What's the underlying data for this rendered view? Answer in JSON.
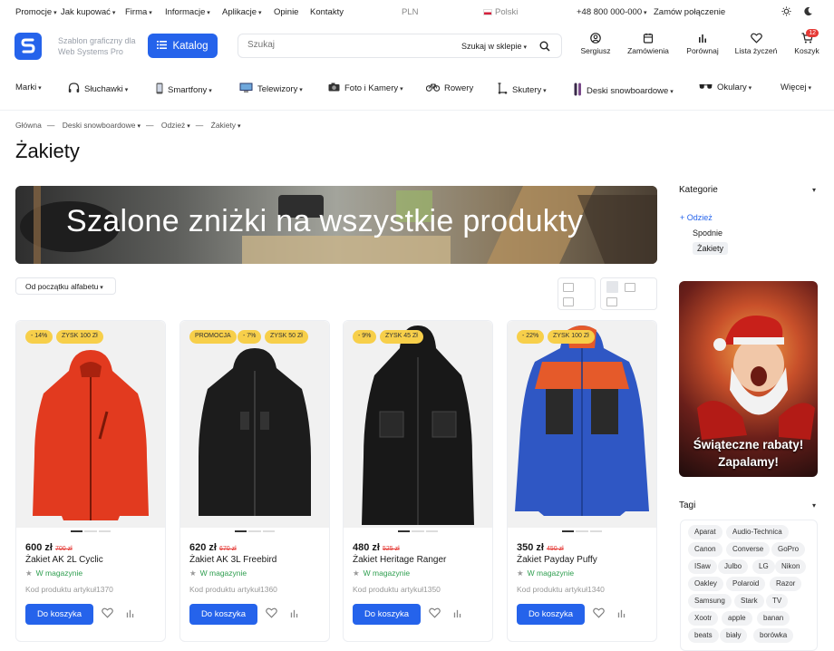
{
  "topbar": {
    "links": [
      "Promocje",
      "Jak kupować",
      "Firma",
      "Informacje",
      "Aplikacje",
      "Opinie",
      "Kontakty"
    ],
    "currency": "PLN",
    "language": "Polski",
    "phone": "+48 800 000-000",
    "callback": "Zamów połączenie"
  },
  "header": {
    "tagline": "Szablon graficzny dla Web Systems Pro",
    "catalog_label": "Katalog",
    "search_placeholder": "Szukaj",
    "search_scope": "Szukaj w sklepie",
    "icons": [
      {
        "label": "Sergiusz",
        "icon": "user-icon"
      },
      {
        "label": "Zamówienia",
        "icon": "orders-icon"
      },
      {
        "label": "Porównaj",
        "icon": "compare-icon"
      },
      {
        "label": "Lista życzeń",
        "icon": "heart-icon"
      },
      {
        "label": "Koszyk",
        "icon": "cart-icon",
        "badge": "12"
      }
    ]
  },
  "nav": {
    "items": [
      "Marki",
      "Słuchawki",
      "Smartfony",
      "Telewizory",
      "Foto i Kamery",
      "Rowery",
      "Skutery",
      "Deski snowboardowe",
      "Okulary",
      "Więcej"
    ]
  },
  "breadcrumb": [
    "Główna",
    "Deski snowboardowe",
    "Odzież",
    "Żakiety"
  ],
  "page_title": "Żakiety",
  "banner_text": "Szalone zniżki na wszystkie produkty",
  "sort_label": "Od początku alfabetu",
  "products": [
    {
      "badges": [
        "- 14%",
        "ZYSK 100 Zł"
      ],
      "price": "600 zł",
      "old_price": "700 zł",
      "name": "Żakiet AK 2L Cyclic",
      "stock": "W magazynie",
      "code_label": "Kod produktu",
      "code": "artykuł1370",
      "cart": "Do koszyka",
      "color": "#e23a1f"
    },
    {
      "badges": [
        "PROMOCJA",
        "- 7%",
        "ZYSK 50 Zł"
      ],
      "price": "620 zł",
      "old_price": "670 zł",
      "name": "Żakiet AK 3L Freebird",
      "stock": "W magazynie",
      "code_label": "Kod produktu",
      "code": "artykuł1360",
      "cart": "Do koszyka",
      "color": "#1c1c1c"
    },
    {
      "badges": [
        "- 9%",
        "ZYSK 45 Zł"
      ],
      "price": "480 zł",
      "old_price": "525 zł",
      "name": "Żakiet Heritage Ranger",
      "stock": "W magazynie",
      "code_label": "Kod produktu",
      "code": "artykuł1350",
      "cart": "Do koszyka",
      "color": "#181818"
    },
    {
      "badges": [
        "- 22%",
        "ZYSK 100 Zł"
      ],
      "price": "350 zł",
      "old_price": "450 zł",
      "name": "Żakiet Payday Puffy",
      "stock": "W magazynie",
      "code_label": "Kod produktu",
      "code": "artykuł1340",
      "cart": "Do koszyka",
      "color": "#2f57c4"
    }
  ],
  "sidebar": {
    "categories_title": "Kategorie",
    "categories": [
      "+ Odzież",
      "Spodnie",
      "Żakiety"
    ],
    "promo_text": [
      "Świąteczne rabaty!",
      "Zapalamy!"
    ],
    "tags_title": "Tagi",
    "tags": [
      "Aparat",
      "Audio-Technica",
      "Canon",
      "Converse",
      "GoPro",
      "ISaw",
      "Julbo",
      "LG",
      "Nikon",
      "Oakley",
      "Polaroid",
      "Razor",
      "Samsung",
      "Stark",
      "TV",
      "Xootr",
      "apple",
      "banan",
      "beats",
      "biały",
      "borówka"
    ]
  },
  "colors": {
    "accent": "#2563eb",
    "badge": "#f7cf4a",
    "stock": "#2e9e4f",
    "old_price": "#e53935"
  }
}
